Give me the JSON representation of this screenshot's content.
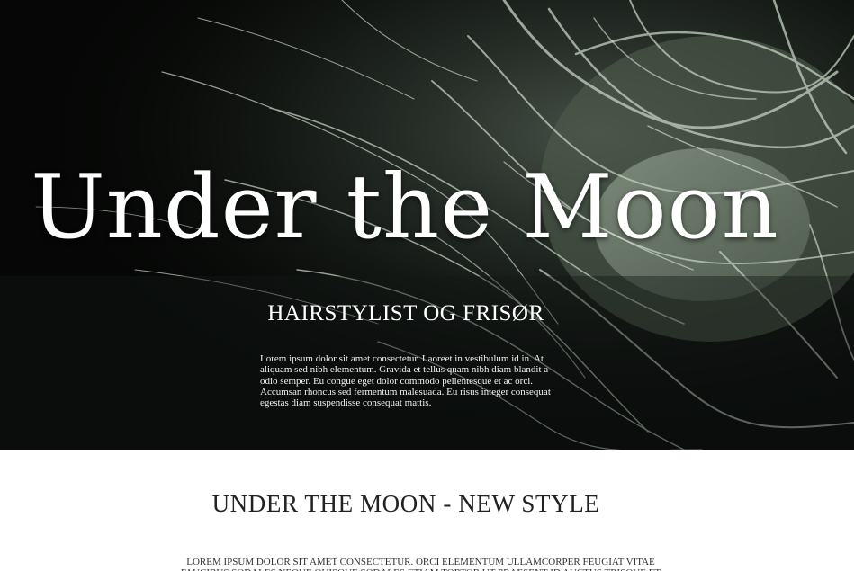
{
  "hero": {
    "title": "Under the Moon",
    "subtitle": "HAIRSTYLIST OG FRISØR",
    "body": "Lorem ipsum dolor sit amet consectetur. Laoreet in vestibulum id in. At aliquam sed nibh elementum. Gravida et tellus quam nibh diam blandit a odio semper. Eu congue eget dolor commodo pellentesque et ac orci. Accumsan rhoncus sed fermentum malesuada. Eu risus integer consequat egestas diam suspendisse consequat mattis."
  },
  "section": {
    "title": "UNDER THE MOON - NEW STYLE",
    "body": "LOREM IPSUM DOLOR SIT AMET CONSECTETUR. ORCI ELEMENTUM ULLAMCORPER FEUGIAT VITAE FAUCIBUS SODALES NEQUE QUISQUE SODALES ETIAM TORTOR UT PRAESENT ID AUCTUS TRISQUE ET"
  },
  "colors": {
    "hero_background": "#050605",
    "hair_tint": "#b9c9b8",
    "page_background": "#ffffff",
    "section_text": "#222222"
  }
}
